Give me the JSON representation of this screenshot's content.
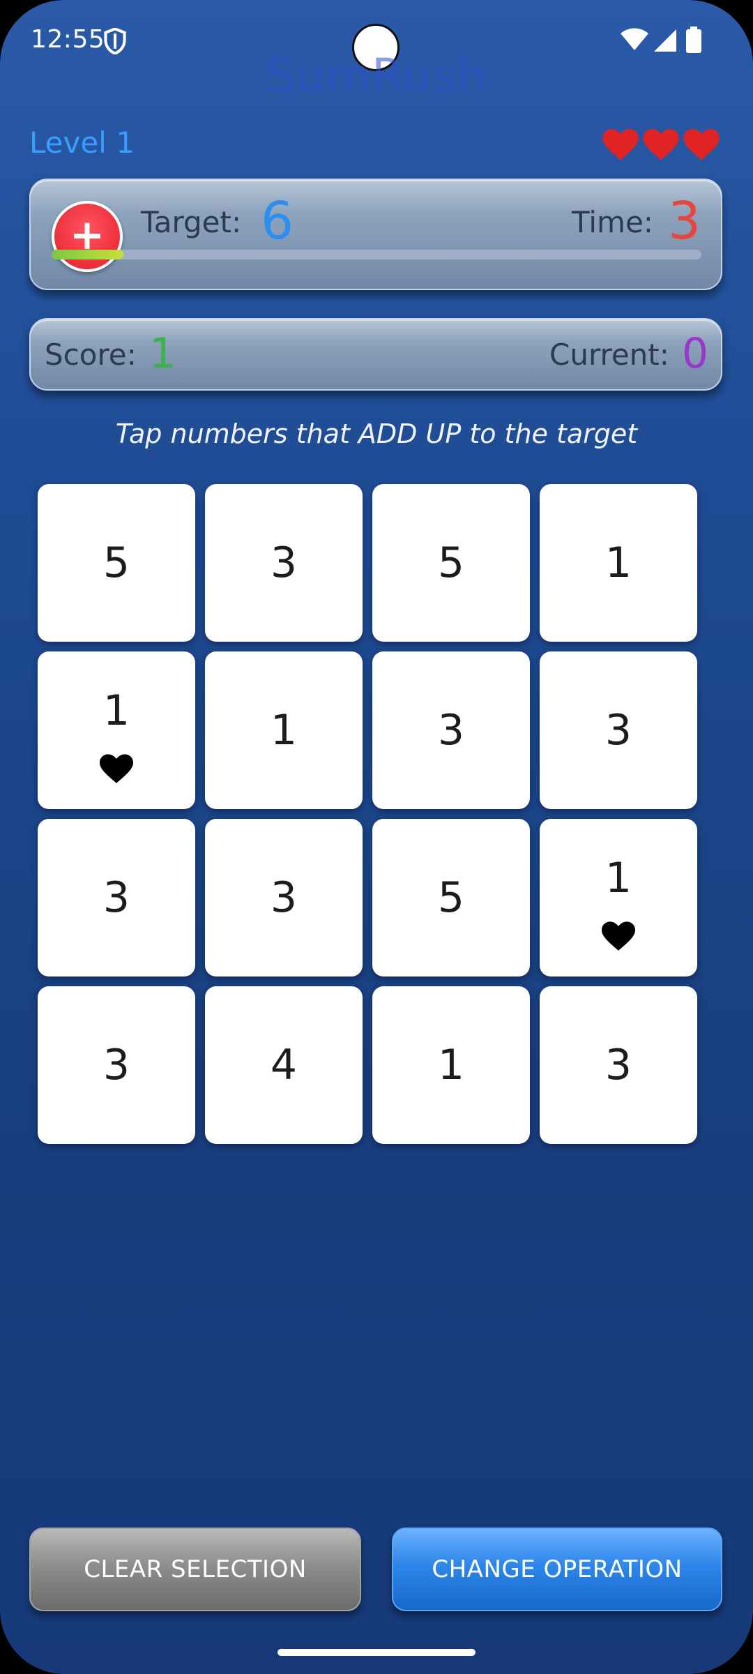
{
  "status_bar": {
    "time": "12:55",
    "icons": [
      "shield-icon",
      "wifi-icon",
      "signal-icon",
      "battery-icon"
    ]
  },
  "app": {
    "title": "SumRush"
  },
  "level": {
    "label": "Level 1"
  },
  "lives": {
    "count": 3,
    "icon": "heart-icon",
    "color": "#e02424"
  },
  "target_panel": {
    "operation_symbol": "+",
    "target_label": "Target:",
    "target_value": "6",
    "time_label": "Time:",
    "time_value": "3",
    "timer_progress": 0.11
  },
  "score_panel": {
    "score_label": "Score:",
    "score_value": "1",
    "current_label": "Current:",
    "current_value": "0"
  },
  "instruction": "Tap numbers that ADD UP to the target",
  "grid": {
    "rows": [
      [
        {
          "value": "5",
          "bonus": false
        },
        {
          "value": "3",
          "bonus": false
        },
        {
          "value": "5",
          "bonus": false
        },
        {
          "value": "1",
          "bonus": false
        }
      ],
      [
        {
          "value": "1",
          "bonus": true
        },
        {
          "value": "1",
          "bonus": false
        },
        {
          "value": "3",
          "bonus": false
        },
        {
          "value": "3",
          "bonus": false
        }
      ],
      [
        {
          "value": "3",
          "bonus": false
        },
        {
          "value": "3",
          "bonus": false
        },
        {
          "value": "5",
          "bonus": false
        },
        {
          "value": "1",
          "bonus": true
        }
      ],
      [
        {
          "value": "3",
          "bonus": false
        },
        {
          "value": "4",
          "bonus": false
        },
        {
          "value": "1",
          "bonus": false
        },
        {
          "value": "3",
          "bonus": false
        }
      ]
    ]
  },
  "buttons": {
    "clear_label": "CLEAR SELECTION",
    "change_label": "CHANGE OPERATION"
  },
  "colors": {
    "accent_blue": "#2b8ff0",
    "time_red": "#e8453c",
    "score_green": "#39b34a",
    "current_purple": "#9b38c9"
  }
}
